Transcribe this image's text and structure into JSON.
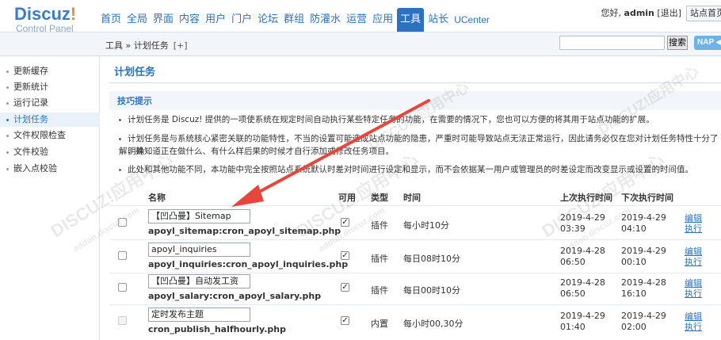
{
  "logo": {
    "brand": "Discuz",
    "bang": "!",
    "sub": "Control Panel"
  },
  "nav": [
    "首页",
    "全局",
    "界面",
    "内容",
    "用户",
    "门户",
    "论坛",
    "群组",
    "防灌水",
    "运营",
    "应用",
    "工具",
    "站长",
    "UCenter"
  ],
  "nav_active_index": 11,
  "userbar": {
    "greeting": "您好,",
    "user": "admin",
    "logout": "[退出]"
  },
  "site_button": "站点首页",
  "breadcrumb": {
    "text": "工具 » 计划任务",
    "add": "[+]"
  },
  "search": {
    "button": "搜索",
    "nap": "NAP ◀"
  },
  "sidebar": [
    {
      "label": "更新缓存",
      "active": false
    },
    {
      "label": "更新统计",
      "active": false
    },
    {
      "label": "运行记录",
      "active": false
    },
    {
      "label": "计划任务",
      "active": true
    },
    {
      "label": "文件权限检查",
      "active": false
    },
    {
      "label": "文件校验",
      "active": false
    },
    {
      "label": "嵌入点校验",
      "active": false
    }
  ],
  "main": {
    "title": "计划任务",
    "tips_title": "技巧提示",
    "tips": [
      "计划任务是 Discuz! 提供的一项使系统在规定时间自动执行某些特定任务的功能，在需要的情况下，您也可以方便的将其用于站点功能的扩展。",
      "计划任务是与系统核心紧密关联的功能特性，不当的设置可能造成站点功能的隐患，严重时可能导致站点无法正常运行，因此请务必仅在您对计划任务特性十分了解，并",
      "明确知道正在做什么、有什么样后果的时候才自行添加或修改任务项目。",
      "此处和其他功能不同，本功能中完全按照站点系统默认时差对时间进行设定和显示，而不会依据某一用户或管理员的时差设定而改变显示或设置的时间值。"
    ]
  },
  "table": {
    "headers": {
      "name": "名称",
      "enabled": "可用",
      "type": "类型",
      "time": "时间",
      "last": "上次执行时间",
      "next": "下次执行时间"
    },
    "rows": [
      {
        "name": "【凹凸曼】Sitemap",
        "file": "apoyl_sitemap:cron_apoyl_sitemap.php",
        "enabled": true,
        "type": "插件",
        "time": "每小时10分",
        "last_date": "2019-4-29",
        "last_time": "03:39",
        "next_date": "2019-4-29",
        "next_time": "04:10",
        "op_edit": "编辑",
        "op_run": "执行"
      },
      {
        "name": "apoyl_inquiries",
        "file": "apoyl_inquiries:cron_apoyl_inquiries.php",
        "enabled": true,
        "type": "插件",
        "time": "每日08时10分",
        "last_date": "2019-4-28",
        "last_time": "06:50",
        "next_date": "2019-4-29",
        "next_time": "00:10",
        "op_edit": "编辑",
        "op_run": "执行"
      },
      {
        "name": "【凹凸曼】自动发工资",
        "file": "apoyl_salary:cron_apoyl_salary.php",
        "enabled": true,
        "type": "插件",
        "time": "每日00时10分",
        "last_date": "2019-4-28",
        "last_time": "06:50",
        "next_date": "2019-4-28",
        "next_time": "16:10",
        "op_edit": "编辑",
        "op_run": "执行"
      },
      {
        "name": "定时发布主题",
        "file": "cron_publish_halfhourly.php",
        "enabled": true,
        "type": "内置",
        "time": "每小时00,30分",
        "last_date": "2019-4-29",
        "last_time": "01:40",
        "next_date": "2019-4-29",
        "next_time": "02:00",
        "op_edit": "编辑",
        "op_run": "执行"
      }
    ]
  },
  "watermark": {
    "text": "DISCUZ!应用中心",
    "sub": "addon.discuz.com"
  },
  "colors": {
    "accent": "#2c72c0",
    "arrow": "#e8463a",
    "logo_orange": "#f08c2c"
  }
}
